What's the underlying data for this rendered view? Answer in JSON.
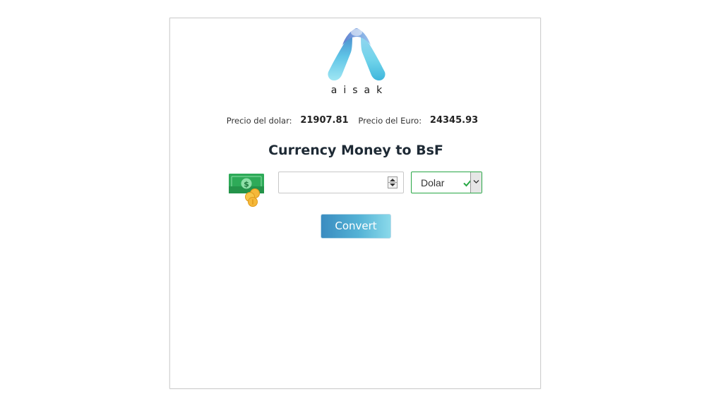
{
  "logo": {
    "text": "aisak"
  },
  "prices": {
    "dolar_label": "Precio del dolar:",
    "dolar_value": "21907.81",
    "euro_label": "Precio del Euro:",
    "euro_value": "24345.93"
  },
  "title": "Currency Money to BsF",
  "form": {
    "amount_value": "",
    "currency_selected": "Dolar",
    "convert_label": "Convert"
  },
  "colors": {
    "accent_green": "#28a745",
    "button_gradient_start": "#3a8cc0",
    "button_gradient_end": "#8ad9ea",
    "logo_cyan": "#6fd3ea",
    "logo_blue": "#3b6fb0"
  },
  "icons": {
    "money": "money-bill-coins-icon",
    "check": "check-icon",
    "dropdown": "chevron-down-icon"
  }
}
